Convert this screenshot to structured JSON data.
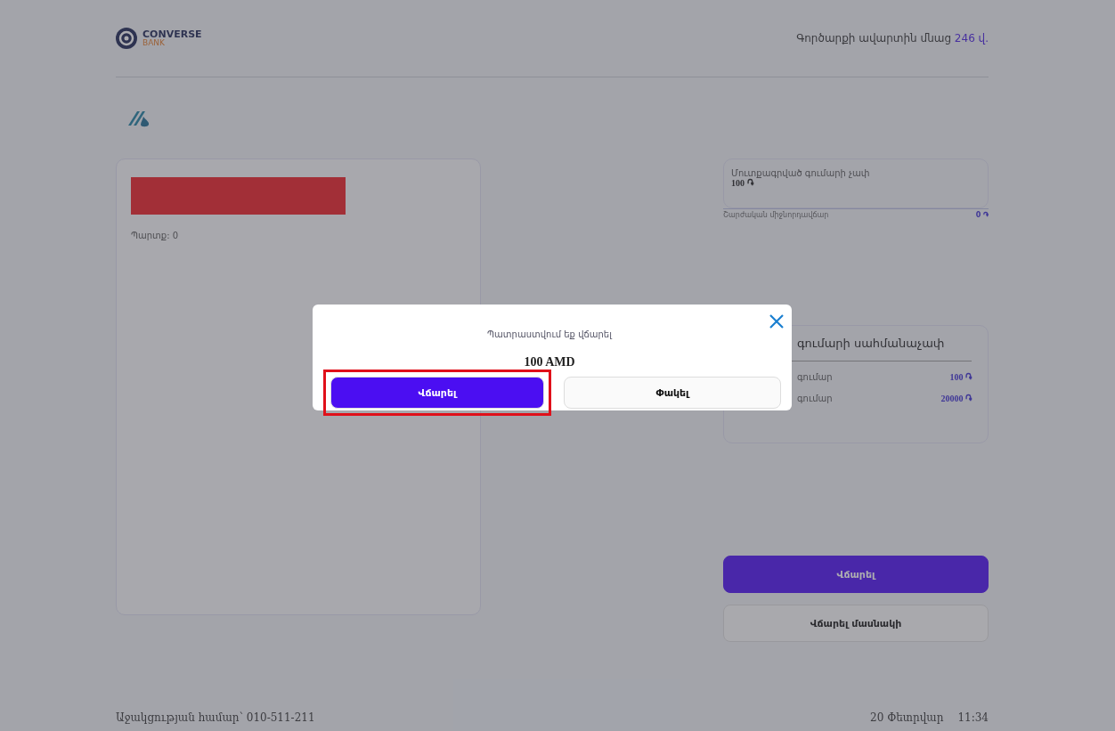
{
  "header": {
    "logo": {
      "name": "CONVERSE",
      "sub": "BANK"
    },
    "timer": {
      "label": "Գործարքի ավարտին մնաց",
      "value": "246 վ."
    }
  },
  "left_card": {
    "balance": "Պարտք: 0"
  },
  "amount_card": {
    "label": "Մուտքագրված գումարի չափ",
    "value": "100 ֏"
  },
  "commission": {
    "label": "Շարժական միջնորդավճար",
    "value": "0 ֏"
  },
  "limits_card": {
    "title": "գումարի սահմանաչափ",
    "rows": [
      {
        "label": "գումար",
        "value": "100 ֏"
      },
      {
        "label": "գումար",
        "value": "20000 ֏"
      }
    ]
  },
  "buttons": [
    {
      "label": "Վճարել",
      "kind": "primary"
    },
    {
      "label": "Վճարել մասնակի",
      "kind": "secondary"
    }
  ],
  "footer": {
    "support": "Աջակցության համար՝ 010-511-211",
    "date": "20 Փետրվար",
    "time": "11:34"
  },
  "modal": {
    "message": "Պատրաստվում եք վճարել",
    "amount": "100 AMD",
    "buttons": [
      {
        "label": "Վճարել",
        "kind": "primary",
        "highlighted": true
      },
      {
        "label": "Փակել",
        "kind": "secondary",
        "highlighted": false
      }
    ]
  }
}
